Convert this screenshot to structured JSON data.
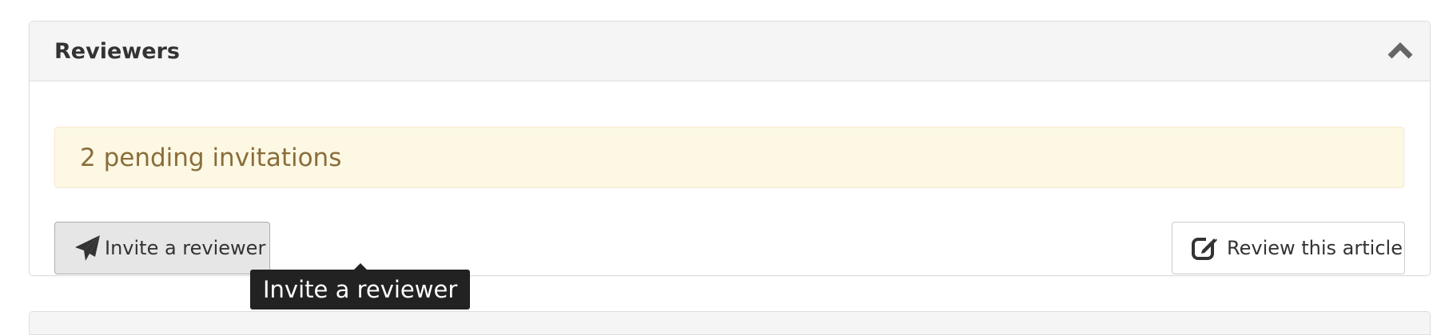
{
  "panel": {
    "title": "Reviewers",
    "collapse_icon": "chevron-up-icon"
  },
  "alert": {
    "text": "2 pending invitations",
    "color": "#8a6d3b",
    "background": "#fcf8e3"
  },
  "buttons": {
    "invite": {
      "label": "Invite a reviewer",
      "icon": "paper-plane-icon"
    },
    "review": {
      "label": "Review this article",
      "icon": "edit-icon"
    }
  },
  "tooltip": {
    "text": "Invite a reviewer"
  }
}
